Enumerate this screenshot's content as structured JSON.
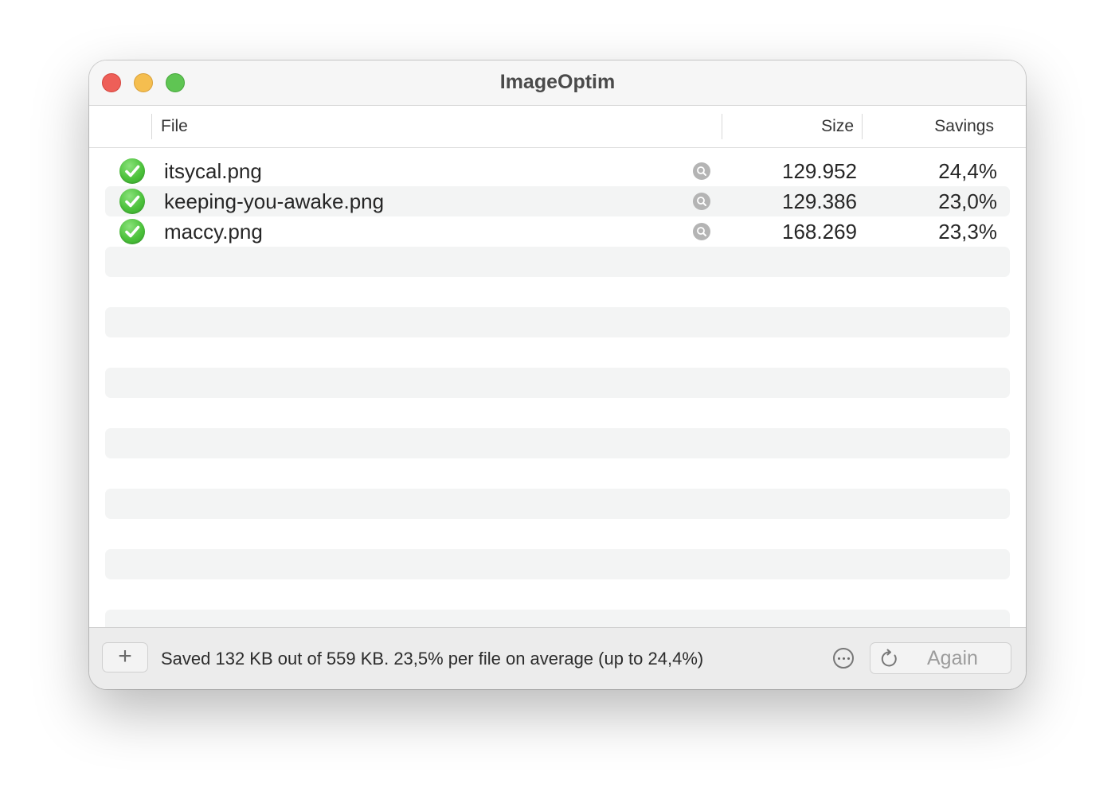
{
  "window": {
    "title": "ImageOptim"
  },
  "columns": {
    "file": "File",
    "size": "Size",
    "savings": "Savings"
  },
  "files": [
    {
      "name": "itsycal.png",
      "size": "129.952",
      "savings": "24,4%"
    },
    {
      "name": "keeping-you-awake.png",
      "size": "129.386",
      "savings": "23,0%"
    },
    {
      "name": "maccy.png",
      "size": "168.269",
      "savings": "23,3%"
    }
  ],
  "footer": {
    "add_label": "+",
    "status": "Saved 132 KB out of 559 KB. 23,5% per file on average (up to 24,4%)",
    "again_label": "Again"
  },
  "icons": {
    "status": "checkmark-circle-icon",
    "preview": "magnifier-icon",
    "more": "ellipsis-circle-icon",
    "again": "refresh-icon"
  },
  "colors": {
    "close": "#ee5f58",
    "minimize": "#f5be4f",
    "maximize": "#5fc553",
    "success": "#4cc13b",
    "stripe": "#f3f4f4"
  }
}
